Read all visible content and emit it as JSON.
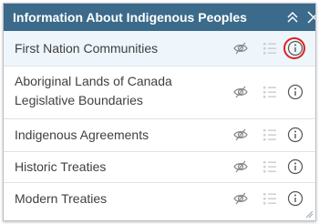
{
  "header": {
    "title": "Information About Indigenous Peoples",
    "background": "#3b6a8a"
  },
  "layers": [
    {
      "line1": "First Nation Communities",
      "line2": "",
      "selected": true
    },
    {
      "line1": "Aboriginal Lands of Canada",
      "line2": "Legislative Boundaries",
      "selected": false
    },
    {
      "line1": "Indigenous Agreements",
      "line2": "",
      "selected": false
    },
    {
      "line1": "Historic Treaties",
      "line2": "",
      "selected": false
    },
    {
      "line1": "Modern Treaties",
      "line2": "",
      "selected": false
    }
  ],
  "icons": {
    "collapse": "chevrons-up-icon",
    "close": "close-icon",
    "visibility": "eye-off-icon",
    "legend": "legend-list-icon",
    "info": "info-icon"
  },
  "colors": {
    "highlight": "#e02020",
    "selected_row": "#eef5fb"
  }
}
